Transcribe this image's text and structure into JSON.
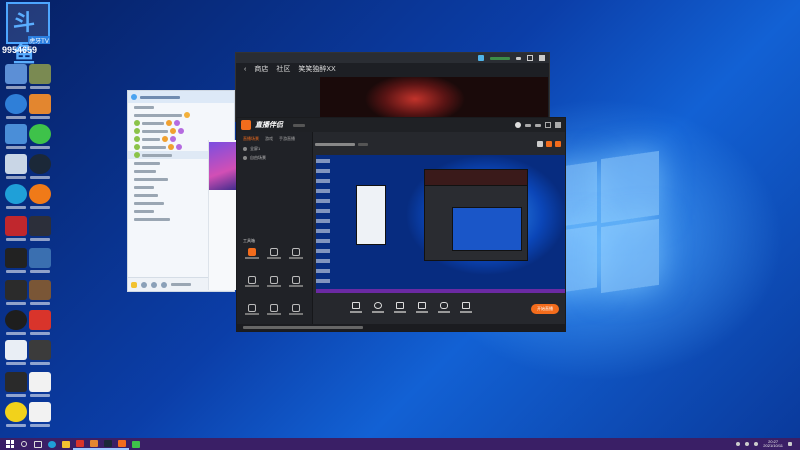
{
  "overlay": {
    "logo_text": "斗鱼",
    "sub_label": "虎牙TV",
    "room_number": "9954659"
  },
  "game_window": {
    "nav": [
      "商店",
      "社区",
      "笑笑独醉XX"
    ]
  },
  "studio": {
    "brand": "直播伴侣",
    "tabs": [
      "直播场景",
      "游戏",
      "手游直播"
    ],
    "scenes": [
      "全屏1",
      "自由场景"
    ],
    "tools_label": "工具箱",
    "live_button": "开始直播",
    "accent": "#f36c1c"
  },
  "taskbar": {
    "time": "20:27",
    "date": "2021/10/11"
  },
  "colors": {
    "taskbar": "#3a1f66",
    "desktop_accent": "#1261d4"
  }
}
